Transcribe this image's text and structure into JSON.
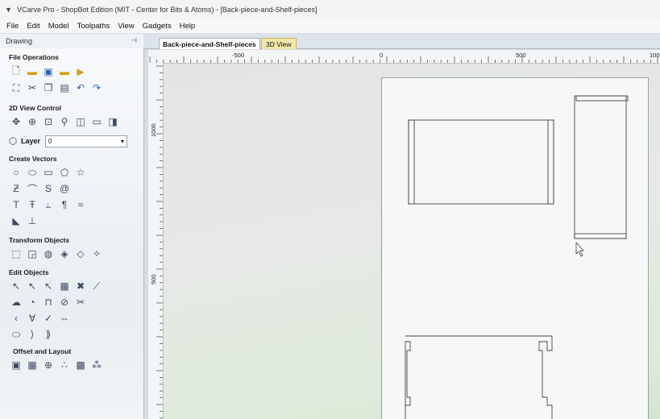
{
  "window": {
    "title": "VCarve Pro - ShopBot Edition (MIT - Center for Bits & Atoms) - [Back-piece-and-Shelf-pieces]"
  },
  "menu": [
    "File",
    "Edit",
    "Model",
    "Toolpaths",
    "View",
    "Gadgets",
    "Help"
  ],
  "panel": {
    "title": "Drawing",
    "sections": {
      "file_operations": "File Operations",
      "view_control": "2D View Control",
      "create_vectors": "Create Vectors",
      "transform_objects": "Transform Objects",
      "edit_objects": "Edit Objects",
      "offset_layout": "Offset and Layout"
    },
    "layer_label": "Layer",
    "layer_value": "0"
  },
  "tabs": {
    "active": "Back-piece-and-Shelf-pieces",
    "view3d": "3D View"
  },
  "ruler": {
    "h_labels": [
      "-500",
      "0",
      "500",
      "100"
    ],
    "v_labels": [
      "1000",
      "500"
    ]
  },
  "icons": {
    "file": [
      "new-file-icon",
      "open-file-icon",
      "save-icon",
      "open-folder-icon",
      "import-icon"
    ],
    "edit": [
      "select-all-icon",
      "cut-icon",
      "copy-icon",
      "paste-icon",
      "undo-icon",
      "redo-icon"
    ],
    "view": [
      "pan-icon",
      "zoom-box-icon",
      "zoom-extents-icon",
      "zoom-icon",
      "split-view-icon",
      "tile-view-icon",
      "toggle-view-icon"
    ],
    "vectors": [
      "circle-icon",
      "ellipse-icon",
      "rectangle-icon",
      "polygon-icon",
      "star-icon",
      "polyline-icon",
      "arc-icon",
      "curve-icon",
      "spiral-icon",
      "text-icon",
      "text-frame-icon",
      "text-on-curve-icon",
      "text-arc-icon",
      "tab-icon",
      "dimension-icon"
    ]
  },
  "colors": {
    "active_tab": "#ffffff",
    "view3d_tab": "#f3e7a9",
    "sheet": "#f6f7f7"
  }
}
